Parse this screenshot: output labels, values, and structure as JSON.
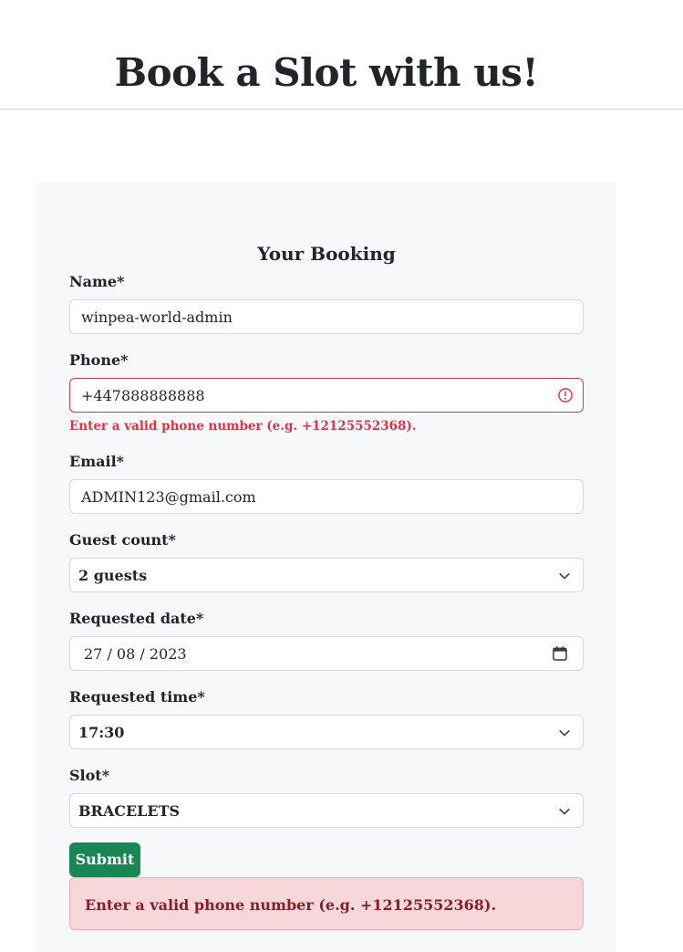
{
  "header": {
    "title": "Book a Slot with us!"
  },
  "form": {
    "title": "Your Booking",
    "name": {
      "label": "Name*",
      "value": "winpea-world-admin"
    },
    "phone": {
      "label": "Phone*",
      "value": "+447888888888",
      "error": "Enter a valid phone number (e.g. +12125552368)."
    },
    "email": {
      "label": "Email*",
      "value": "ADMIN123@gmail.com"
    },
    "guest_count": {
      "label": "Guest count*",
      "value": "2 guests"
    },
    "requested_date": {
      "label": "Requested date*",
      "value": "27 / 08 / 2023"
    },
    "requested_time": {
      "label": "Requested time*",
      "value": "17:30"
    },
    "slot": {
      "label": "Slot*",
      "value": "BRACELETS"
    },
    "submit_label": "Submit",
    "alert_message": "Enter a valid phone number (e.g. +12125552368)."
  },
  "colors": {
    "error": "#dc3545",
    "submit": "#198754",
    "alert_bg": "#f8d7da",
    "alert_text": "#842029"
  },
  "icons": {
    "select": "chevron-down-icon",
    "date": "calendar-icon",
    "invalid": "alert-circle-icon"
  }
}
